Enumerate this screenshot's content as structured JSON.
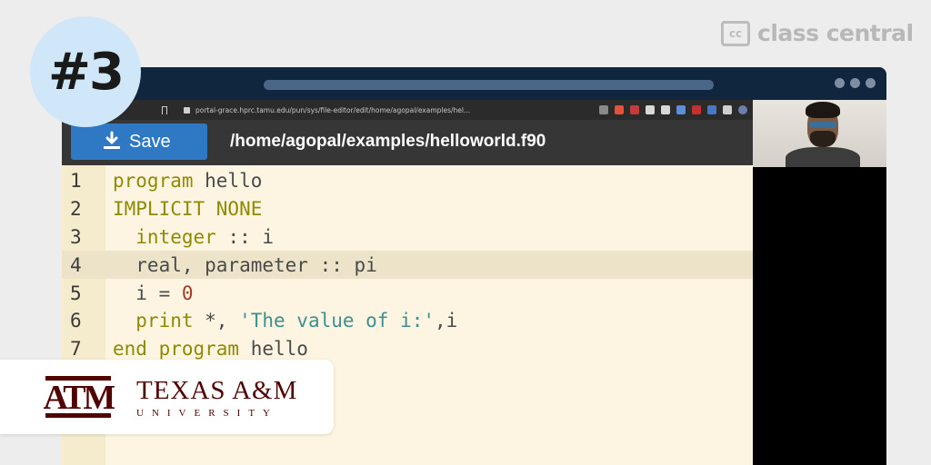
{
  "brand": {
    "logo_text": "cc",
    "name": "class central"
  },
  "episode_badge": "#3",
  "browser": {
    "url": "portal-grace.hprc.tamu.edu/pun/sys/file-editor/edit/home/agopal/examples/hel..."
  },
  "editor": {
    "save_label": "Save",
    "file_path": "/home/agopal/examples/helloworld.f90",
    "active_line": 4,
    "lines": [
      {
        "n": "1",
        "parts": [
          {
            "t": "program",
            "c": "kw"
          },
          {
            "t": " hello",
            "c": ""
          }
        ]
      },
      {
        "n": "2",
        "parts": [
          {
            "t": "IMPLICIT NONE",
            "c": "kw"
          }
        ]
      },
      {
        "n": "3",
        "parts": [
          {
            "t": "  integer",
            "c": "kw"
          },
          {
            "t": " :: i",
            "c": ""
          }
        ]
      },
      {
        "n": "4",
        "parts": [
          {
            "t": "  real, parameter :: pi",
            "c": ""
          }
        ]
      },
      {
        "n": "5",
        "parts": [
          {
            "t": "  i = ",
            "c": ""
          },
          {
            "t": "0",
            "c": "num"
          }
        ]
      },
      {
        "n": "6",
        "parts": [
          {
            "t": "  print",
            "c": "kw"
          },
          {
            "t": " *, ",
            "c": ""
          },
          {
            "t": "'The value of i:'",
            "c": "str"
          },
          {
            "t": ",i",
            "c": ""
          }
        ]
      },
      {
        "n": "7",
        "parts": [
          {
            "t": "end program",
            "c": "kw"
          },
          {
            "t": " hello",
            "c": ""
          }
        ]
      }
    ]
  },
  "university": {
    "name": "TEXAS A&M",
    "subtitle": "UNIVERSITY",
    "logo_text": "ATM"
  },
  "colors": {
    "frame": "#10263f",
    "editor_bg": "#fdf5e1",
    "save_button": "#2e78c4",
    "keyword": "#8f8a00",
    "string": "#3f8f8f",
    "maroon": "#500000"
  }
}
